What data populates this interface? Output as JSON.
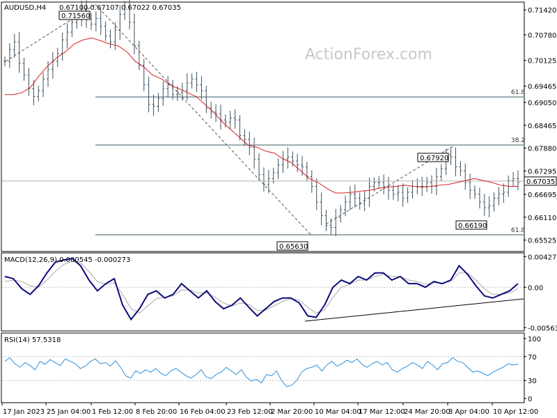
{
  "header": {
    "symbol": "AUDUSD,H4",
    "ohlc": "0.67100 0.67107 0.67022 0.67035"
  },
  "watermark": "ActionForex.com",
  "colors": {
    "bar": "#3c4f5c",
    "ma": "#d42020",
    "macd": "#0b0b7a",
    "signal": "#a9a9a9",
    "rsi": "#2f8fd8",
    "fib": "#3a5a66",
    "grid": "#c0c0c0",
    "price_line": "#b0b0b0"
  },
  "chart_data": [
    {
      "type": "ohlc",
      "title": "AUDUSD,H4",
      "ylim": [
        0.6525,
        0.716
      ],
      "y_ticks": [
        "0.71420",
        "0.70780",
        "0.70125",
        "0.69465",
        "0.69050",
        "0.68465",
        "0.67880",
        "0.67295",
        "0.66695",
        "0.66110",
        "0.65525"
      ],
      "x_ticks": [
        "17 Jan 2023",
        "25 Jan 04:00",
        "1 Feb 12:00",
        "8 Feb 20:00",
        "16 Feb 04:00",
        "23 Feb 12:00",
        "2 Mar 20:00",
        "10 Mar 04:00",
        "17 Mar 12:00",
        "24 Mar 20:00",
        "3 Apr 04:00",
        "10 Apr 12:00"
      ],
      "last_price": "0.67035",
      "series": [
        {
          "name": "",
          "values": [
            0.701,
            0.704,
            0.706,
            0.7005,
            0.6975,
            0.694,
            0.692,
            0.6935,
            0.6965,
            0.699,
            0.701,
            0.703,
            0.7065,
            0.7085,
            0.711,
            0.712,
            0.7145,
            0.712,
            0.7105,
            0.712,
            0.71,
            0.7075,
            0.706,
            0.709,
            0.713,
            0.715,
            0.711,
            0.705,
            0.7,
            0.695,
            0.69,
            0.6895,
            0.6915,
            0.694,
            0.695,
            0.6925,
            0.693,
            0.6935,
            0.6955,
            0.6965,
            0.695,
            0.6935,
            0.689,
            0.688,
            0.6875,
            0.686,
            0.6855,
            0.6865,
            0.686,
            0.682,
            0.681,
            0.679,
            0.676,
            0.672,
            0.6695,
            0.671,
            0.6725,
            0.6745,
            0.676,
            0.6765,
            0.6755,
            0.6745,
            0.674,
            0.6715,
            0.669,
            0.665,
            0.6615,
            0.659,
            0.6585,
            0.661,
            0.663,
            0.665,
            0.667,
            0.666,
            0.6645,
            0.666,
            0.669,
            0.67,
            0.67,
            0.669,
            0.668,
            0.667,
            0.6675,
            0.666,
            0.6675,
            0.669,
            0.669,
            0.669,
            0.67,
            0.669,
            0.6715,
            0.6735,
            0.677,
            0.6765,
            0.674,
            0.673,
            0.67,
            0.668,
            0.667,
            0.665,
            0.6635,
            0.664,
            0.666,
            0.667,
            0.6675,
            0.6705,
            0.671,
            0.67
          ]
        },
        {
          "name": "",
          "values": [
            0.6925,
            0.6925,
            0.693,
            0.6945,
            0.6975,
            0.7,
            0.702,
            0.7035,
            0.7055,
            0.7065,
            0.707,
            0.7063,
            0.7055,
            0.705,
            0.7035,
            0.701,
            0.6995,
            0.6975,
            0.6965,
            0.695,
            0.694,
            0.693,
            0.692,
            0.69,
            0.688,
            0.6855,
            0.6835,
            0.6815,
            0.6795,
            0.679,
            0.678,
            0.6775,
            0.676,
            0.675,
            0.673,
            0.671,
            0.67,
            0.6685,
            0.6673,
            0.6673,
            0.6675,
            0.6678,
            0.668,
            0.6685,
            0.6688,
            0.669,
            0.6693,
            0.669,
            0.6688,
            0.669,
            0.6693,
            0.6695,
            0.67,
            0.6705,
            0.671,
            0.6705,
            0.67,
            0.6693,
            0.669,
            0.669
          ]
        }
      ],
      "fib_levels": [
        {
          "label": "61.8",
          "value": 0.6919
        },
        {
          "label": "38.2",
          "value": 0.6796
        },
        {
          "label": "61.8",
          "value": 0.6566
        }
      ],
      "annotations": [
        {
          "label": "0.71560",
          "value": 0.7156
        },
        {
          "label": "0.65630",
          "value": 0.6563
        },
        {
          "label": "0.67920",
          "value": 0.6792
        },
        {
          "label": "0.66190",
          "value": 0.6619
        }
      ]
    },
    {
      "type": "line",
      "title": "MACD(12,26,9) 0.000545 -0.000273",
      "ylim": [
        -0.0058,
        0.0045
      ],
      "y_ticks": [
        "0.004278",
        "0.00",
        "-0.005635"
      ],
      "series": [
        {
          "name": "",
          "values": [
            0.0015,
            0.0012,
            -0.0002,
            -0.001,
            0.0002,
            0.002,
            0.0035,
            0.0038,
            0.004,
            0.003,
            0.001,
            -0.0005,
            0.0005,
            0.0012,
            -0.0025,
            -0.0045,
            -0.003,
            -0.001,
            -0.0005,
            -0.0015,
            -0.001,
            0.0005,
            -0.0005,
            -0.0015,
            -0.0005,
            -0.002,
            -0.003,
            -0.0025,
            -0.0015,
            -0.0028,
            -0.004,
            -0.003,
            -0.002,
            -0.0015,
            -0.0015,
            -0.0022,
            -0.004,
            -0.0042,
            -0.0025,
            0.0,
            0.001,
            0.0005,
            0.0015,
            0.001,
            0.002,
            0.002,
            0.001,
            0.0015,
            0.0005,
            0.0005,
            0.0,
            0.0008,
            0.0005,
            0.001,
            0.003,
            0.0018,
            0.0002,
            -0.0012,
            -0.0015,
            -0.001,
            -0.0005,
            0.0005
          ]
        },
        {
          "name": "",
          "values": [
            0.0008,
            0.001,
            0.0008,
            0.0002,
            0.0,
            0.001,
            0.0022,
            0.0032,
            0.0036,
            0.0034,
            0.0022,
            0.0008,
            0.0004,
            0.0006,
            -0.001,
            -0.003,
            -0.0036,
            -0.0026,
            -0.0016,
            -0.0014,
            -0.0012,
            -0.0004,
            -0.0004,
            -0.0008,
            -0.0008,
            -0.0014,
            -0.0022,
            -0.0026,
            -0.0022,
            -0.0024,
            -0.0032,
            -0.0032,
            -0.0026,
            -0.002,
            -0.0016,
            -0.0018,
            -0.0028,
            -0.0036,
            -0.0032,
            -0.0014,
            0.0,
            0.0004,
            0.001,
            0.001,
            0.0015,
            0.0018,
            0.0015,
            0.0015,
            0.001,
            0.0008,
            0.0004,
            0.0006,
            0.0006,
            0.0008,
            0.002,
            0.002,
            0.001,
            -0.0002,
            -0.001,
            -0.001,
            -0.0008,
            -0.0002
          ]
        }
      ]
    },
    {
      "type": "line",
      "title": "RSI(14) 57.5318",
      "ylim": [
        0,
        100
      ],
      "y_ticks": [
        "100",
        "70",
        "30",
        "0"
      ],
      "series": [
        {
          "name": "",
          "values": [
            62,
            68,
            58,
            52,
            60,
            55,
            48,
            62,
            57,
            65,
            60,
            55,
            66,
            62,
            58,
            50,
            54,
            62,
            66,
            58,
            60,
            54,
            63,
            52,
            38,
            34,
            46,
            42,
            48,
            44,
            50,
            42,
            38,
            46,
            50,
            44,
            38,
            34,
            40,
            48,
            36,
            33,
            40,
            44,
            52,
            46,
            40,
            48,
            36,
            29,
            32,
            26,
            40,
            38,
            46,
            30,
            20,
            22,
            30,
            44,
            50,
            52,
            56,
            46,
            56,
            62,
            54,
            58,
            64,
            60,
            66,
            57,
            52,
            58,
            62,
            56,
            60,
            48,
            44,
            50,
            54,
            60,
            56,
            50,
            62,
            56,
            48,
            58,
            60,
            68,
            62,
            60,
            52,
            44,
            46,
            42,
            38,
            44,
            48,
            52,
            58,
            56,
            57
          ]
        }
      ]
    }
  ]
}
